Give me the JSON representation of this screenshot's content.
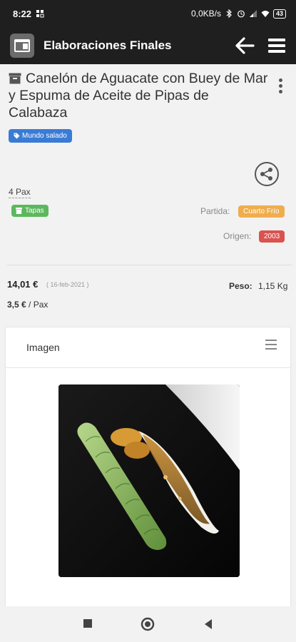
{
  "status_bar": {
    "time": "8:22",
    "network_speed": "0,0KB/s",
    "battery": "43"
  },
  "app_bar": {
    "title": "Elaboraciones Finales"
  },
  "recipe": {
    "title": "Canelón de Aguacate con Buey de Mar y Espuma de Aceite de Pipas de Calabaza",
    "category_tag": "Mundo salado",
    "servings": "4 Pax",
    "type_tag": "Tapas",
    "partida_label": "Partida:",
    "partida_value": "Cuarto Frío",
    "origen_label": "Origen:",
    "origen_value": "2003",
    "price": "14,01 €",
    "price_date": "( 16-feb-2021 )",
    "peso_label": "Peso:",
    "peso_value": "1,15 Kg",
    "price_per_pax_value": "3,5 €",
    "price_per_pax_unit": " / Pax"
  },
  "image_card": {
    "title": "Imagen"
  },
  "colors": {
    "appbar_bg": "#1f1f1f",
    "tag_blue": "#3a7bd5",
    "tag_green": "#5cb85c",
    "badge_orange": "#f0ad4e",
    "badge_red": "#d9534f",
    "fab": "#e04848"
  },
  "icons": {
    "app_logo": "window-icon",
    "back": "arrow-left-icon",
    "menu": "hamburger-icon",
    "title": "archive-box-icon",
    "more": "kebab-icon",
    "share": "share-icon",
    "chat": "chat-icon"
  }
}
